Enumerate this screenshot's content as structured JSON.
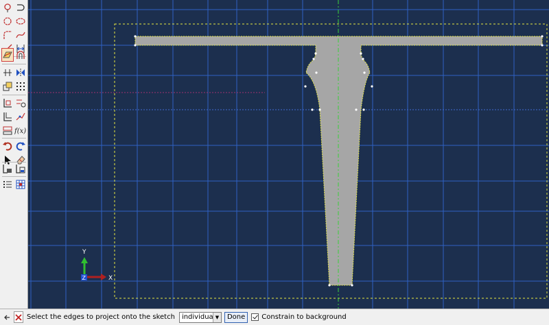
{
  "toolbox": {
    "rows": [
      {
        "left": "isolate-point-icon",
        "right": "arc-tangent-icon"
      },
      {
        "left": "circle-icon",
        "right": "ellipse-icon"
      },
      {
        "left": "fillet-icon",
        "right": "spline-icon"
      },
      {
        "left": "line-icon",
        "right": "dimension-icon"
      },
      {
        "left": "project-edges-icon",
        "right": "offset-arc-icon"
      },
      {
        "left": "constraint-icon",
        "right": "mirror-icon"
      },
      {
        "left": "translate-icon",
        "right": "grid-snap-icon"
      },
      {
        "left": "edit-dimension-icon",
        "right": "sketch-options-icon"
      },
      {
        "left": "parameter-icon",
        "right": "move-vertex-icon"
      },
      {
        "left": "reference-icon",
        "right": "function-icon"
      },
      {
        "left": "undo-icon",
        "right": "redo-icon"
      },
      {
        "left": "select-arrow-icon",
        "right": "delete-eraser-icon"
      },
      {
        "left": "save-sketch-icon",
        "right": "retrieve-sketch-icon"
      },
      {
        "left": "list-icon",
        "right": "grid-table-icon"
      }
    ]
  },
  "canvas": {
    "triad": {
      "y_label": "Y",
      "x_label": "X",
      "z_label": "Z"
    }
  },
  "statusbar": {
    "prompt": "Select the edges to project onto the sketch",
    "mode_value": "individually",
    "done_label": "Done",
    "constrain_label": "Constrain to background",
    "constrain_checked": true
  },
  "colors": {
    "canvas_bg": "#1c2f4e",
    "grid_line": "#2f62c4",
    "part_fill": "#a6a6a6",
    "outline_dash": "#e8e840",
    "centerline": "#3ad03a"
  }
}
